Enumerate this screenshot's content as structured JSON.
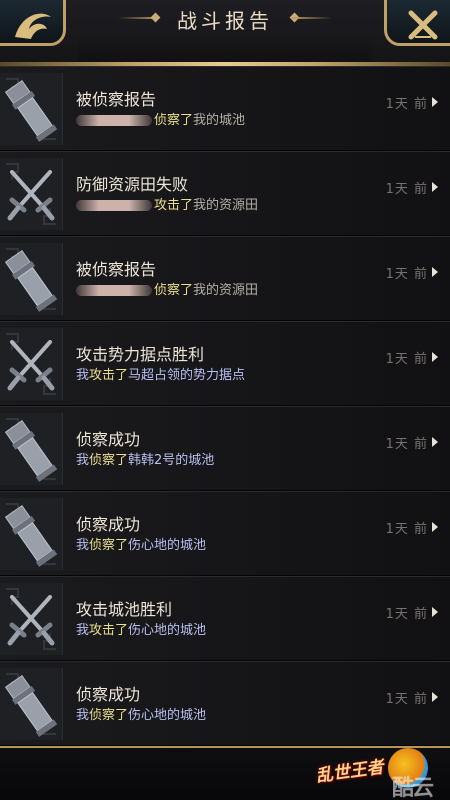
{
  "header": {
    "title": "战斗报告"
  },
  "reports": [
    {
      "icon": "spy",
      "title": "被侦察报告",
      "actor": "",
      "actor_hidden": true,
      "verb": "侦察了",
      "target": "我的城池",
      "target_class": "plain",
      "time": "1天  前"
    },
    {
      "icon": "swords",
      "title": "防御资源田失败",
      "actor": "",
      "actor_hidden": true,
      "verb": "攻击了",
      "target": "我的资源田",
      "target_class": "plain",
      "time": "1天  前"
    },
    {
      "icon": "spy",
      "title": "被侦察报告",
      "actor": "",
      "actor_hidden": true,
      "verb": "侦察了",
      "target": "我的资源田",
      "target_class": "plain",
      "time": "1天  前"
    },
    {
      "icon": "swords",
      "title": "攻击势力据点胜利",
      "actor": "我",
      "actor_hidden": false,
      "verb": "攻击了",
      "target": "马超占领的势力据点",
      "target_class": "plain",
      "time": "1天  前"
    },
    {
      "icon": "spy",
      "title": "侦察成功",
      "actor": "我",
      "actor_hidden": false,
      "verb": "侦察了",
      "target": "韩韩2号的城池",
      "target_class": "plain",
      "time": "1天  前"
    },
    {
      "icon": "spy",
      "title": "侦察成功",
      "actor": "我",
      "actor_hidden": false,
      "verb": "侦察了",
      "target": "伤心地的城池",
      "target_class": "plain",
      "time": "1天  前"
    },
    {
      "icon": "swords",
      "title": "攻击城池胜利",
      "actor": "我",
      "actor_hidden": false,
      "verb": "攻击了",
      "target": "伤心地的城池",
      "target_class": "plain",
      "time": "1天  前"
    },
    {
      "icon": "spy",
      "title": "侦察成功",
      "actor": "我",
      "actor_hidden": false,
      "verb": "侦察了",
      "target": "伤心地的城池",
      "target_class": "plain",
      "time": "1天  前"
    }
  ],
  "footer": {
    "logo_text": "乱世王者",
    "watermark": "酷云米"
  },
  "colors": {
    "gold": "#c0a064",
    "verb": "#eadf8e",
    "name": "#b9bff0"
  }
}
